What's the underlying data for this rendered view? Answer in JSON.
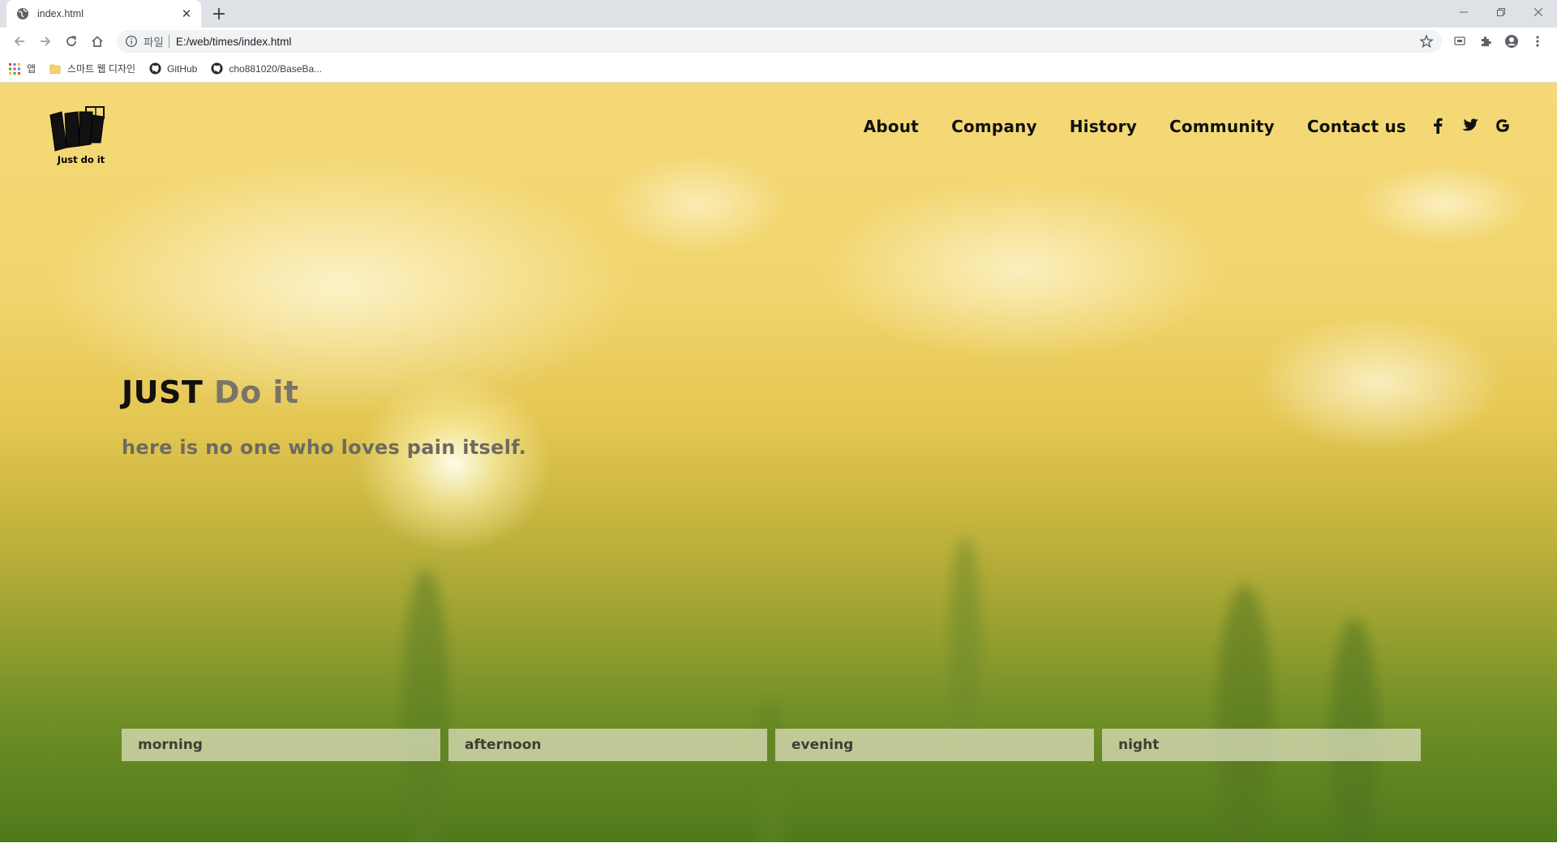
{
  "browser": {
    "tab_title": "index.html",
    "omnibox": {
      "scheme_label": "파일",
      "url": "E:/web/times/index.html"
    },
    "bookmarks": [
      {
        "label": "앱",
        "icon": "apps-grid-icon"
      },
      {
        "label": "스마트 웹 디자인",
        "icon": "folder-icon"
      },
      {
        "label": "GitHub",
        "icon": "github-icon"
      },
      {
        "label": "cho881020/BaseBa...",
        "icon": "github-icon"
      }
    ]
  },
  "site": {
    "logo_text": "Just do it",
    "nav": [
      "About",
      "Company",
      "History",
      "Community",
      "Contact us"
    ],
    "social": [
      "facebook-icon",
      "twitter-icon",
      "google-icon"
    ]
  },
  "hero": {
    "title_strong": "JUST",
    "title_light": "Do it",
    "subtitle": "here is no one who loves pain itself."
  },
  "times": [
    "morning",
    "afternoon",
    "evening",
    "night"
  ]
}
